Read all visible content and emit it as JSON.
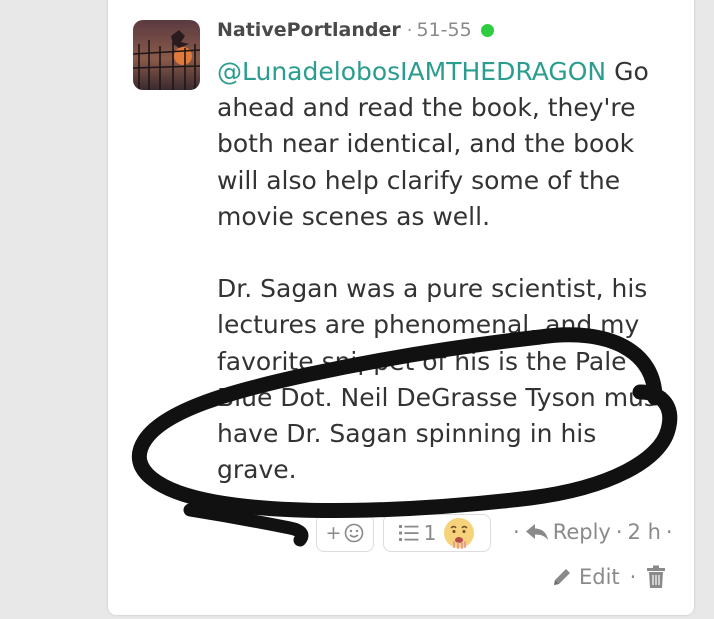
{
  "comment": {
    "username": "NativePortlander",
    "separator": "·",
    "age_range": "51-55",
    "mention": "@LunadelobosIAMTHEDRAGON",
    "paragraph1_rest": " Go ahead and read the book, they're both near identical, and the book will also help clarify some of the movie scenes as well.",
    "paragraph2": "Dr. Sagan was a pure scientist, his lectures are phenomenal, and my favorite snippet of his is the Pale Blue Dot. Neil DeGrasse Tyson must have Dr. Sagan spinning in his grave."
  },
  "actions": {
    "react_plus": "+",
    "reply_count": "1",
    "dot": "·",
    "reply_label": "Reply",
    "time": "2 h",
    "edit_label": "Edit"
  },
  "colors": {
    "mention": "#2a9d8f",
    "online": "#2ecc40",
    "scribble": "#111111"
  }
}
